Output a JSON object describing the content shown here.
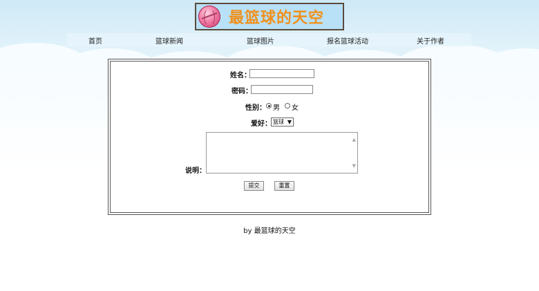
{
  "header": {
    "logo_text": "最篮球的天空"
  },
  "nav": {
    "items": [
      "首页",
      "篮球新闻",
      "篮球图片",
      "报名篮球活动",
      "关于作者"
    ]
  },
  "form": {
    "name_label": "姓名：",
    "name_value": "",
    "password_label": "密码：",
    "password_value": "",
    "gender_label": "性别：",
    "gender_options": [
      "男",
      "女"
    ],
    "gender_selected": "男",
    "hobby_label": "爱好：",
    "hobby_selected": "篮球",
    "description_label": "说明：",
    "description_value": "",
    "submit_label": "提交",
    "reset_label": "重置"
  },
  "footer": {
    "text": "by 最篮球的天空"
  }
}
